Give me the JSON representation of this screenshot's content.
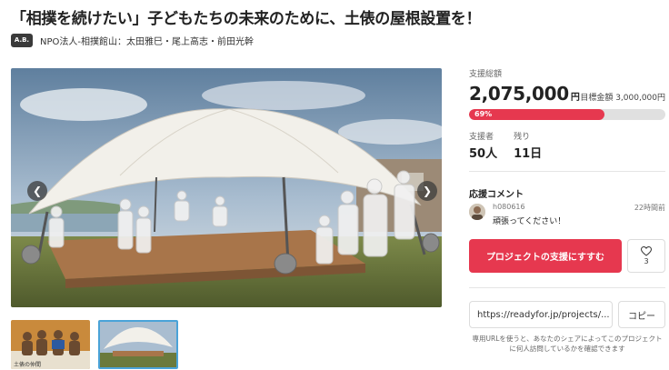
{
  "page": {
    "title": "「相撲を続けたい」子どもたちの未来のために、土俵の屋根設置を！"
  },
  "owner": {
    "logo_text": "A.B.",
    "name": "NPO法人-相撲館山：太田雅巳・尾上高志・前田光幹"
  },
  "gallery": {
    "prev_icon": "chevron-left-icon",
    "next_icon": "chevron-right-icon",
    "thumb1_caption": "土俵の仲間"
  },
  "funding": {
    "total_label": "支援総額",
    "total_amount": "2,075,000",
    "total_unit": "円",
    "goal_text": "目標金額 3,000,000円",
    "progress_percent_text": "69%",
    "progress_fraction": 0.69,
    "supporters_label": "支援者",
    "supporters_value": "50人",
    "remaining_label": "残り",
    "remaining_value": "11日"
  },
  "comments": {
    "heading": "応援コメント",
    "items": [
      {
        "user": "h080616",
        "time": "22時間前",
        "text": "頑張ってください！"
      }
    ]
  },
  "actions": {
    "support_label": "プロジェクトの支援にすすむ",
    "favorite_icon": "heart-icon",
    "favorite_count": "3"
  },
  "share": {
    "url_value": "https://readyfor.jp/projects/...",
    "copy_label": "コピー",
    "note": "専用URLを使うと、あなたのシェアによってこのプロジェクトに何人訪問しているかを確認できます"
  },
  "colors": {
    "accent": "#e6384f",
    "progress_track": "#e0e0e0",
    "thumb_selected_border": "#4aa3d8"
  }
}
